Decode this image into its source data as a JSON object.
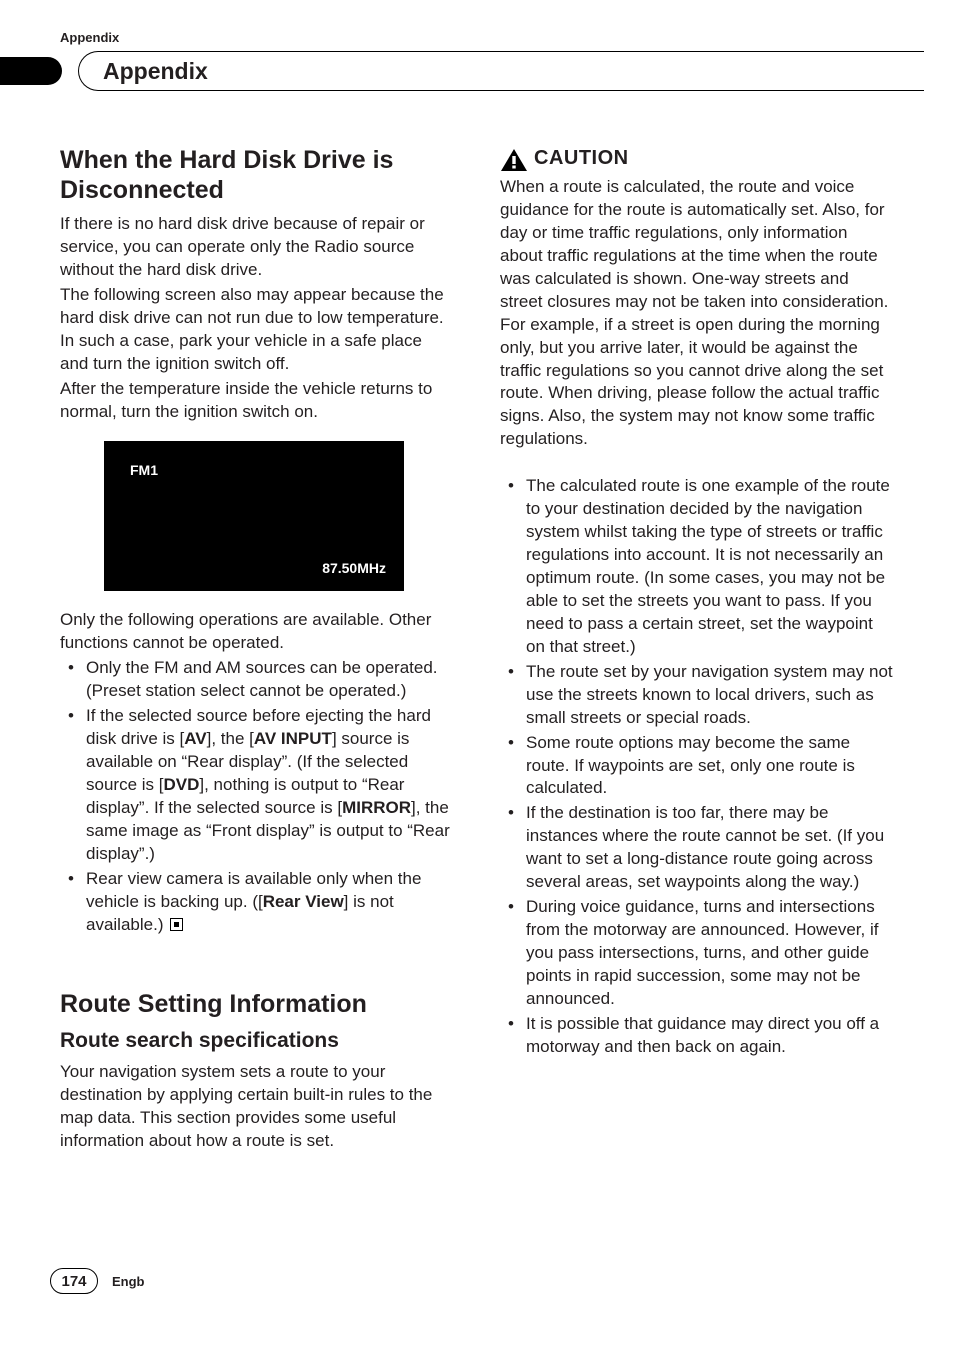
{
  "running_head": "Appendix",
  "chapter_title": "Appendix",
  "left": {
    "h2": "When the Hard Disk Drive is Disconnected",
    "p1": "If there is no hard disk drive because of repair or service, you can operate only the Radio source without the hard disk drive.",
    "p2": "The following screen also may appear because the hard disk drive can not run due to low temperature. In such a case, park your vehicle in a safe place and turn the ignition switch off.",
    "p3": "After the temperature inside the vehicle returns to normal, turn the ignition switch on.",
    "radio": {
      "band": "FM1",
      "freq": "87.50MHz"
    },
    "p4": "Only the following operations are available. Other functions cannot be operated.",
    "b1": "Only the FM and AM sources can be operated. (Preset station select cannot be operated.)",
    "b2_a": "If the selected source before ejecting the hard disk drive is [",
    "b2_av": "AV",
    "b2_b": "], the [",
    "b2_avinput": "AV INPUT",
    "b2_c": "] source is available on “Rear display”. (If the selected source is [",
    "b2_dvd": "DVD",
    "b2_d": "], nothing is output to “Rear display”. If the selected source is [",
    "b2_mirror": "MIRROR",
    "b2_e": "], the same image as “Front display” is output to “Rear display”.)",
    "b3_a": "Rear view camera is available only when the vehicle is backing up. ([",
    "b3_rv": "Rear View",
    "b3_b": "] is not available.)",
    "h2b": "Route Setting Information",
    "h3": "Route search specifications",
    "p5": "Your navigation system sets a route to your destination by applying certain built-in rules to the map data. This section provides some useful information about how a route is set."
  },
  "right": {
    "caution": "CAUTION",
    "p1": "When a route is calculated, the route and voice guidance for the route is automatically set. Also, for day or time traffic regulations, only information about traffic regulations at the time when the route was calculated is shown. One-way streets and street closures may not be taken into consideration. For example, if a street is open during the morning only, but you arrive later, it would be against the traffic regulations so you cannot drive along the set route. When driving, please follow the actual traffic signs. Also, the system may not know some traffic regulations.",
    "b1": "The calculated route is one example of the route to your destination decided by the navigation system whilst taking the type of streets or traffic regulations into account. It is not necessarily an optimum route. (In some cases, you may not be able to set the streets you want to pass. If you need to pass a certain street, set the waypoint on that street.)",
    "b2": "The route set by your navigation system may not use the streets known to local drivers, such as small streets or special roads.",
    "b3": "Some route options may become the same route. If waypoints are set, only one route is calculated.",
    "b4": "If the destination is too far, there may be instances where the route cannot be set. (If you want to set a long-distance route going across several areas, set waypoints along the way.)",
    "b5": "During voice guidance, turns and intersections from the motorway are announced. However, if you pass intersections, turns, and other guide points in rapid succession, some may not be announced.",
    "b6": "It is possible that guidance may direct you off a motorway and then back on again."
  },
  "footer": {
    "page": "174",
    "lang": "Engb"
  }
}
